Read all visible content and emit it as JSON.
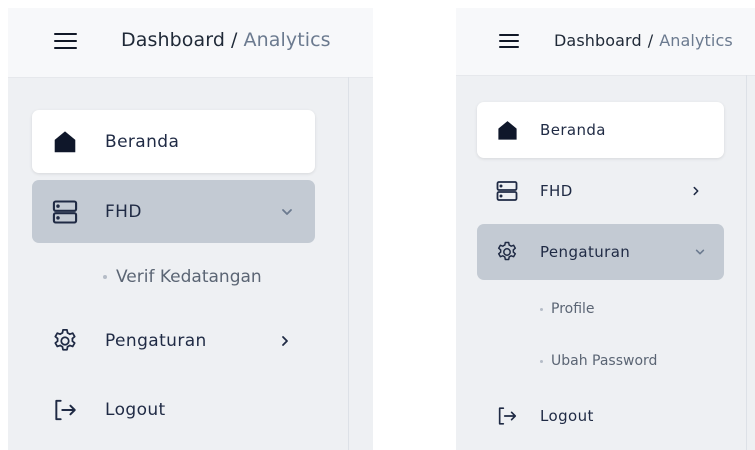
{
  "left_panel": {
    "breadcrumb": {
      "parent": "Dashboard",
      "separator": "/",
      "current": "Analytics"
    },
    "menu": {
      "beranda": {
        "label": "Beranda",
        "icon": "home-icon",
        "state": "active"
      },
      "fhd": {
        "label": "FHD",
        "icon": "server-icon",
        "state": "expanded",
        "chevron": "chevron-down-icon"
      },
      "fhd_submenu": [
        "Verif Kedatangan"
      ],
      "pengaturan": {
        "label": "Pengaturan",
        "icon": "gear-icon",
        "state": "collapsed",
        "chevron": "chevron-right-icon"
      },
      "logout": {
        "label": "Logout",
        "icon": "logout-icon"
      }
    }
  },
  "right_panel": {
    "breadcrumb": {
      "parent": "Dashboard",
      "separator": "/",
      "current": "Analytics"
    },
    "menu": {
      "beranda": {
        "label": "Beranda",
        "icon": "home-icon",
        "state": "active"
      },
      "fhd": {
        "label": "FHD",
        "icon": "server-icon",
        "state": "collapsed",
        "chevron": "chevron-right-icon"
      },
      "pengaturan": {
        "label": "Pengaturan",
        "icon": "gear-icon",
        "state": "expanded",
        "chevron": "chevron-down-icon"
      },
      "pengaturan_submenu": [
        "Profile",
        "Ubah Password"
      ],
      "logout": {
        "label": "Logout",
        "icon": "logout-icon"
      }
    }
  },
  "colors": {
    "sidebar_bg": "#eef0f3",
    "topbar_bg": "#f7f8fa",
    "active_item_bg": "#ffffff",
    "expanded_item_bg": "#c3cad3",
    "text": "#1f2a44",
    "muted_text": "#6b7a8f",
    "icon_dark": "#0f172a"
  }
}
